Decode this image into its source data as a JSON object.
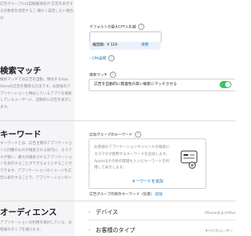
{
  "top_section": {
    "description": "広告グループには自動最適化が 広告を表示する対象者を指定するこ 細かく設定したい場合は",
    "daily_cap_label": "デフォルトの最大CPT入札額",
    "suggested_label": "推奨額：¥ 120",
    "apply_label": "適用",
    "cpa_label": "CPA目標"
  },
  "search_match": {
    "title": "検索マッチ",
    "description": "検索マッチでは広告を自動。類似するApp Storeの広告を簡単な方法です。お客様のアプリケーションと類似しているアプリを検索しているユーザーに、自動的に広告を表示します。",
    "label": "検索マッチ",
    "toggle_text": "広告を自動的に関連性の高い検索にマッチさせる",
    "toggle_on": true
  },
  "keywords": {
    "title": "キーワード",
    "description": "キーワードとは、広告主側のアプリケーションと同種のものが検索される語句に、ホスマネが使い、最大の検索されるアプリケーションを表示することができるようにすることができます。アプリケーションのイメージを広告に表示することで、アプリケーションのインストール数が増加します。",
    "box_label": "広告グループのキーワード",
    "box_text": "お客様のアプリケーションやジャンルの検索にホスマネが使用するキーワードを追加します。Appleはその他の関連も入ったキーワードを利用して表示します。",
    "add_link": "キーワードを追加",
    "negative_label": "広告グループの除外キーワード（任意）",
    "negative_add": "追加"
  },
  "audience": {
    "title": "オーディエンス",
    "description": "アプリケーションの利用を検討している、お客様のタイプを選びます。",
    "rows": [
      {
        "label": "デバイス",
        "value": "iPhoneおよびiPad"
      },
      {
        "label": "お客様のタイプ",
        "value": "すべてのユーザー"
      }
    ]
  },
  "colors": {
    "accent": "#0070c9",
    "toggle_on": "#34c759",
    "sidebar_bg": "#f5f5f7"
  },
  "icons": {
    "help": "help-circle-icon",
    "chevron": "chevron-right-icon",
    "keyword_illustration": "keyword-card-icon"
  }
}
